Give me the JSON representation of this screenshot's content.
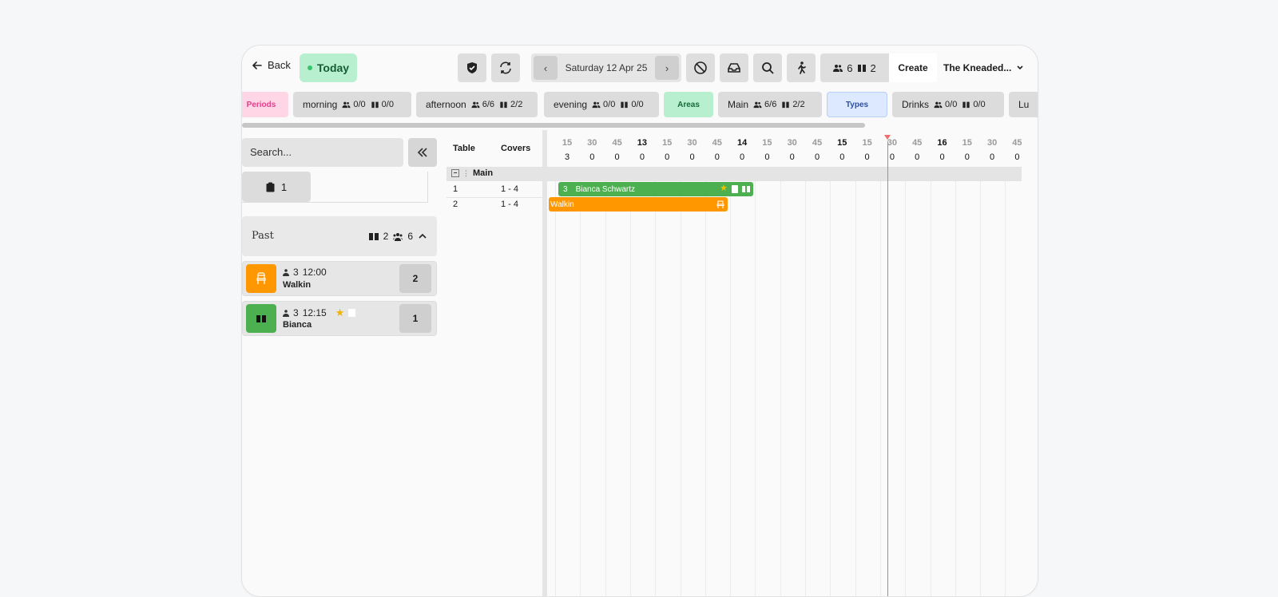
{
  "topbar": {
    "back_label": "Back",
    "today_label": "Today",
    "date_label": "Saturday 12 Apr 25",
    "covers_count": "6",
    "bookings_count": "2",
    "create_label": "Create",
    "venue_label": "The Kneaded..."
  },
  "chips": {
    "periods": "Periods",
    "morning": {
      "label": "morning",
      "covers": "0/0",
      "bookings": "0/0"
    },
    "afternoon": {
      "label": "afternoon",
      "covers": "6/6",
      "bookings": "2/2"
    },
    "evening": {
      "label": "evening",
      "covers": "0/0",
      "bookings": "0/0"
    },
    "areas": "Areas",
    "main": {
      "label": "Main",
      "covers": "6/6",
      "bookings": "2/2"
    },
    "types": "Types",
    "drinks": {
      "label": "Drinks",
      "covers": "0/0",
      "bookings": "0/0"
    },
    "lunch": "Lu"
  },
  "sidebar": {
    "search_placeholder": "Search...",
    "clipboard_count": "1",
    "past": {
      "label": "Past",
      "bookings": "2",
      "covers": "6"
    },
    "cards": [
      {
        "covers": "3",
        "time": "12:00",
        "name": "Walkin",
        "table": "2"
      },
      {
        "covers": "3",
        "time": "12:15",
        "name": "Bianca",
        "table": "1"
      }
    ]
  },
  "grid": {
    "col_table": "Table",
    "col_covers": "Covers",
    "area": "Main",
    "ticks": [
      "15",
      "30",
      "45",
      "13",
      "15",
      "30",
      "45",
      "14",
      "15",
      "30",
      "45",
      "15",
      "15",
      "30",
      "45",
      "16",
      "15",
      "30",
      "45"
    ],
    "counts": [
      "3",
      "0",
      "0",
      "0",
      "0",
      "0",
      "0",
      "0",
      "0",
      "0",
      "0",
      "0",
      "0",
      "0",
      "0",
      "0",
      "0",
      "0",
      "0"
    ],
    "tables": [
      {
        "table": "1",
        "covers": "1 - 4"
      },
      {
        "table": "2",
        "covers": "1 - 4"
      }
    ],
    "reservations": [
      {
        "covers": "3",
        "name": "Bianca Schwartz"
      },
      {
        "name": "Walkin"
      }
    ]
  },
  "colors": {
    "green": "#4caf50",
    "orange": "#ff9800",
    "now_line": "#f06b6b"
  }
}
